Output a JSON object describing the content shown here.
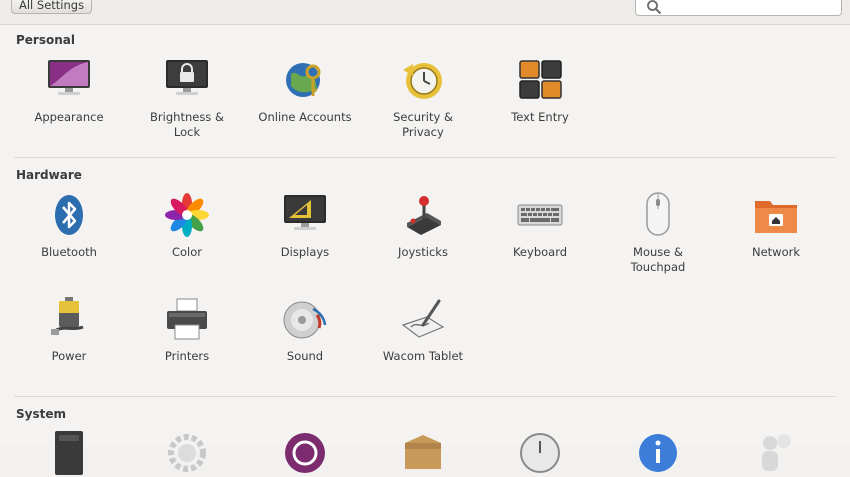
{
  "toolbar": {
    "all_settings": "All Settings",
    "search_placeholder": ""
  },
  "sections": {
    "personal": {
      "title": "Personal",
      "items": [
        {
          "label": "Appearance",
          "icon": "appearance-icon"
        },
        {
          "label": "Brightness &\nLock",
          "icon": "brightness-lock-icon"
        },
        {
          "label": "Online Accounts",
          "icon": "online-accounts-icon"
        },
        {
          "label": "Security &\nPrivacy",
          "icon": "security-privacy-icon"
        },
        {
          "label": "Text Entry",
          "icon": "text-entry-icon"
        }
      ]
    },
    "hardware": {
      "title": "Hardware",
      "items": [
        {
          "label": "Bluetooth",
          "icon": "bluetooth-icon"
        },
        {
          "label": "Color",
          "icon": "color-icon"
        },
        {
          "label": "Displays",
          "icon": "displays-icon"
        },
        {
          "label": "Joysticks",
          "icon": "joystick-icon"
        },
        {
          "label": "Keyboard",
          "icon": "keyboard-icon"
        },
        {
          "label": "Mouse &\nTouchpad",
          "icon": "mouse-icon"
        },
        {
          "label": "Network",
          "icon": "network-icon"
        },
        {
          "label": "Power",
          "icon": "power-icon"
        },
        {
          "label": "Printers",
          "icon": "printer-icon"
        },
        {
          "label": "Sound",
          "icon": "sound-icon"
        },
        {
          "label": "Wacom Tablet",
          "icon": "wacom-tablet-icon"
        }
      ]
    },
    "system": {
      "title": "System"
    }
  }
}
